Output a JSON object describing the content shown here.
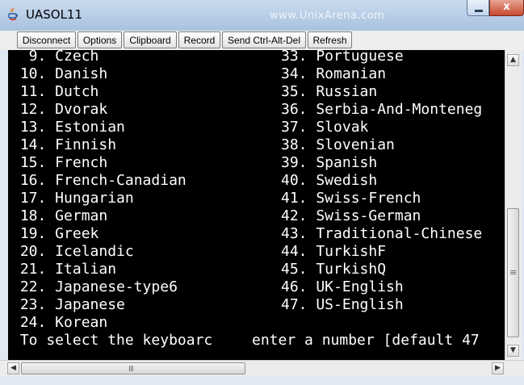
{
  "window": {
    "title": "UASOL11",
    "watermark": "www.UnixArena.com",
    "close_glyph": "x"
  },
  "toolbar": {
    "buttons": [
      "Disconnect",
      "Options",
      "Clipboard",
      "Record",
      "Send Ctrl-Alt-Del",
      "Refresh"
    ]
  },
  "terminal": {
    "left_column": [
      "  9. Czech",
      " 10. Danish",
      " 11. Dutch",
      " 12. Dvorak",
      " 13. Estonian",
      " 14. Finnish",
      " 15. French",
      " 16. French-Canadian",
      " 17. Hungarian",
      " 18. German",
      " 19. Greek",
      " 20. Icelandic",
      " 21. Italian",
      " 22. Japanese-type6",
      " 23. Japanese",
      " 24. Korean",
      " To select the keyboarc"
    ],
    "right_column": [
      "33. Portuguese",
      "34. Romanian",
      "35. Russian",
      "36. Serbia-And-Monteneg",
      "37. Slovak",
      "38. Slovenian",
      "39. Spanish",
      "40. Swedish",
      "41. Swiss-French",
      "42. Swiss-German",
      "43. Traditional-Chinese",
      "44. TurkishF",
      "45. TurkishQ",
      "46. UK-English",
      "47. US-English"
    ],
    "prompt_tail": "enter a number [default 47"
  },
  "scrollbars": {
    "up_arrow": "▲",
    "down_arrow": "▼",
    "left_arrow": "◀",
    "right_arrow": "▶"
  },
  "colors": {
    "terminal_bg": "#000000",
    "terminal_fg": "#ffffff",
    "titlebar": "#b7cde6"
  }
}
